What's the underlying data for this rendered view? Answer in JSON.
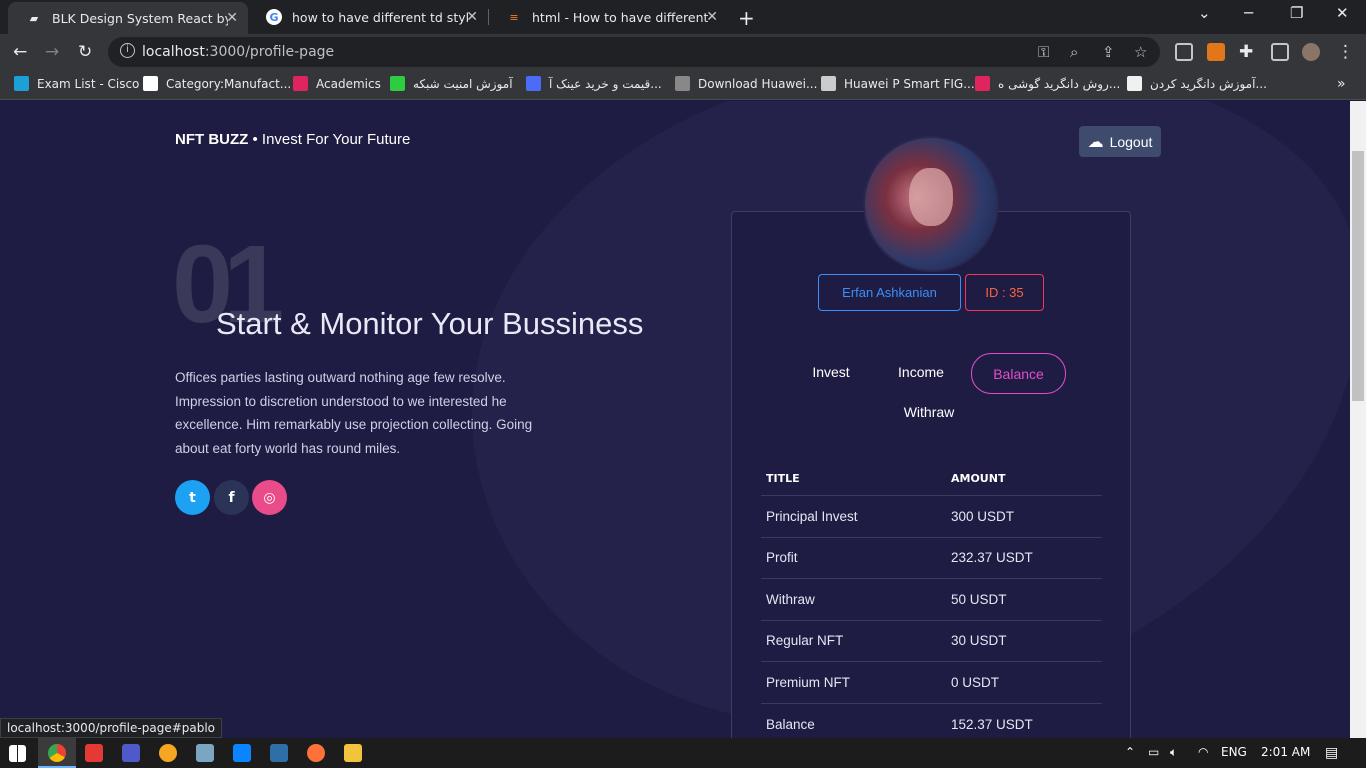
{
  "browser": {
    "tabs": [
      {
        "title": "BLK Design System React by Crea",
        "active": true
      },
      {
        "title": "how to have different td styles in",
        "active": false
      },
      {
        "title": "html - How to have different tabl",
        "active": false
      }
    ],
    "url_host": "localhost",
    "url_rest": ":3000/profile-page",
    "bookmarks": [
      {
        "label": "Exam List - Cisco",
        "color": "#1ba0d7"
      },
      {
        "label": "Category:Manufact...",
        "color": "#ffffff"
      },
      {
        "label": "Academics",
        "color": "#e0245e"
      },
      {
        "label": "آموزش امنیت شبکه",
        "color": "#2ecc40"
      },
      {
        "label": "قیمت و خرید عینک آ...",
        "color": "#4a6cf7"
      },
      {
        "label": "Download Huawei...",
        "color": "#888888"
      },
      {
        "label": "Huawei P Smart FIG...",
        "color": "#cccccc"
      },
      {
        "label": "روش دانگرید گوشی ه...",
        "color": "#e0245e"
      },
      {
        "label": "آموزش دانگرید کردن...",
        "color": "#f0f0f0"
      }
    ],
    "status_url": "localhost:3000/profile-page#pablo"
  },
  "page": {
    "brand_bold": "NFT BUZZ",
    "brand_rest": " • Invest For Your Future",
    "logout_label": "Logout",
    "big_number": "01",
    "hero_title": "Start & Monitor Your Bussiness",
    "hero_desc": "Offices parties lasting outward nothing age few resolve. Impression to discretion understood to we interested he excellence. Him remarkably use projection collecting. Going about eat forty world has round miles.",
    "social": [
      {
        "name": "twitter",
        "glyph": "t",
        "color": "#1da1f2"
      },
      {
        "name": "facebook",
        "glyph": "f",
        "color": "#2b3356"
      },
      {
        "name": "dribbble",
        "glyph": "◎",
        "color": "#ea4c89"
      }
    ]
  },
  "profile": {
    "name": "Erfan Ashkanian",
    "id_label": "ID : 35",
    "tabs": [
      "Invest",
      "Income",
      "Balance",
      "Withraw"
    ],
    "active_tab": "Balance",
    "table": {
      "headers": [
        "TITLE",
        "AMOUNT"
      ],
      "rows": [
        {
          "title": "Principal Invest",
          "amount": "300 USDT"
        },
        {
          "title": "Profit",
          "amount": "232.37 USDT"
        },
        {
          "title": "Withraw",
          "amount": "50 USDT"
        },
        {
          "title": "Regular NFT",
          "amount": "30 USDT"
        },
        {
          "title": "Premium NFT",
          "amount": "0 USDT"
        },
        {
          "title": "Balance",
          "amount": "152.37 USDT"
        }
      ]
    }
  },
  "taskbar": {
    "lang": "ENG",
    "time": "2:01 AM"
  }
}
